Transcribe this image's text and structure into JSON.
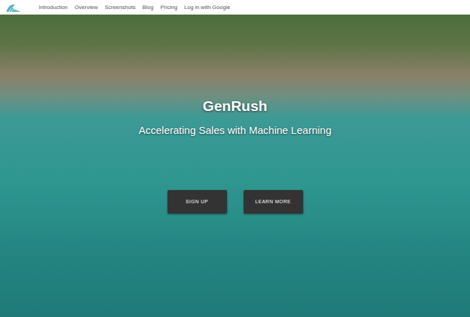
{
  "nav": {
    "items": [
      "Introduction",
      "Overview",
      "Screenshots",
      "Blog",
      "Pricing",
      "Log in with Google"
    ]
  },
  "hero": {
    "title": "GenRush",
    "subtitle": "Accelerating Sales with Machine Learning"
  },
  "buttons": [
    "SIGN UP",
    "LEARN MORE"
  ]
}
